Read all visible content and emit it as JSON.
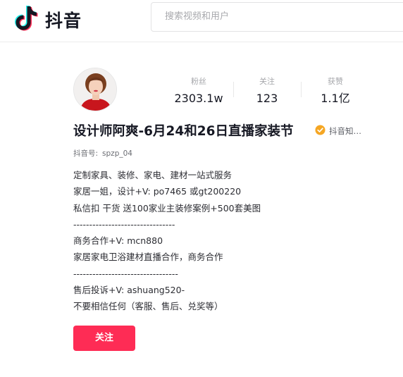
{
  "header": {
    "logo_text": "抖音",
    "search_placeholder": "搜索视频和用户"
  },
  "profile": {
    "stats": [
      {
        "label": "粉丝",
        "value": "2303.1w"
      },
      {
        "label": "关注",
        "value": "123"
      },
      {
        "label": "获赞",
        "value": "1.1亿"
      }
    ],
    "name": "设计师阿爽-6月24和26日直播家装节",
    "verify_label": "抖音知…",
    "id_label": "抖音号:",
    "id_value": "spzp_04",
    "bio_lines": [
      "定制家具、装修、家电、建材一站式服务",
      "家居一姐，设计+V: po7465 或gt200220",
      "私信扣 干货 送100家业主装修案例+500套美图",
      "--------------------------------",
      "商务合作+V: mcn880",
      "家居家电卫浴建材直播合作，商务合作",
      "---------------------------------",
      "售后投诉+V: ashuang520-",
      "不要相信任何（客服、售后、兑奖等）"
    ],
    "follow_label": "关注"
  },
  "colors": {
    "accent": "#fe2c55",
    "verify": "#f5a623"
  }
}
